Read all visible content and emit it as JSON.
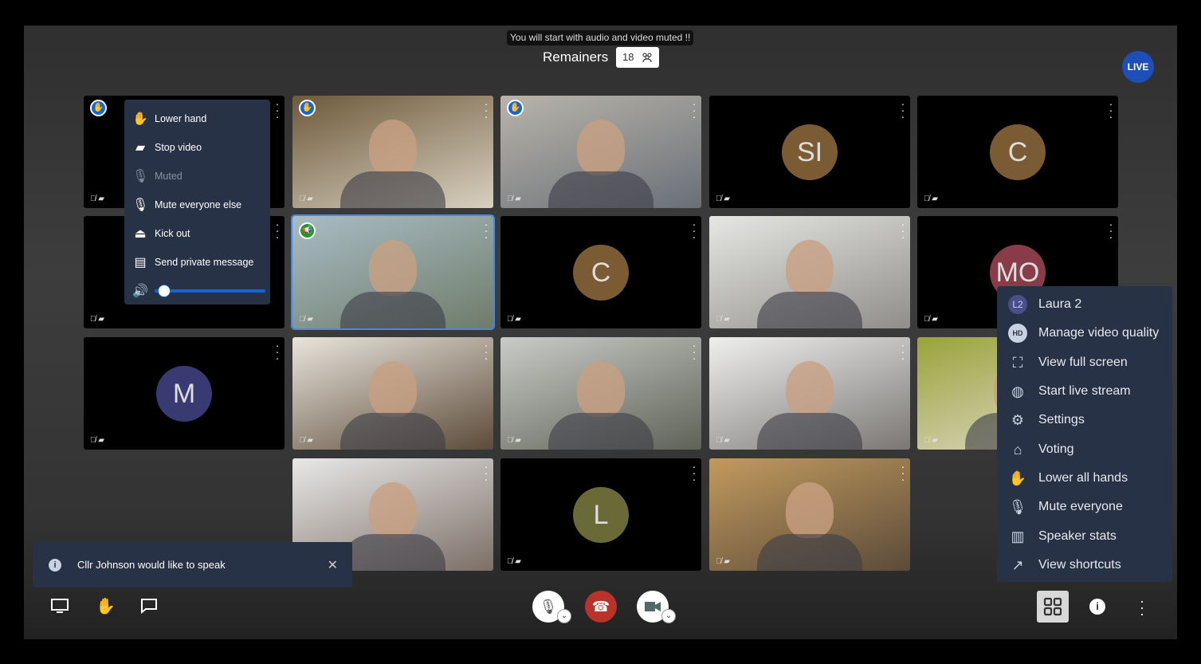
{
  "notice": "You will start with audio and video muted !!",
  "conference": {
    "title": "Remainers",
    "participant_count": "18"
  },
  "live_badge": "LIVE",
  "tiles": [
    {
      "type": "avatar",
      "initials": "",
      "hand": true
    },
    {
      "type": "video",
      "hand": true,
      "colors": [
        "#6e5a3c",
        "#d8d0c0"
      ]
    },
    {
      "type": "video",
      "hand": true,
      "colors": [
        "#b8b4aa",
        "#6a6f78"
      ]
    },
    {
      "type": "avatar",
      "initials": "SI",
      "color": "#7a5b33"
    },
    {
      "type": "avatar",
      "initials": "C",
      "color": "#7a5b33"
    },
    {
      "type": "avatar",
      "initials": ""
    },
    {
      "type": "video",
      "selected": true,
      "speaker": true,
      "colors": [
        "#a9bcc4",
        "#6f7c6a"
      ]
    },
    {
      "type": "avatar",
      "initials": "C",
      "color": "#7a5b33"
    },
    {
      "type": "video",
      "colors": [
        "#e6e6e4",
        "#8f8e8a"
      ]
    },
    {
      "type": "avatar",
      "initials": "MO",
      "color": "#8a3b4a"
    },
    {
      "type": "avatar",
      "initials": "M",
      "color": "#3a3a72"
    },
    {
      "type": "video",
      "colors": [
        "#e9e4dc",
        "#5c4b3a"
      ]
    },
    {
      "type": "video",
      "colors": [
        "#c9cbc8",
        "#5f6256"
      ]
    },
    {
      "type": "video",
      "colors": [
        "#efefee",
        "#7a7774"
      ]
    },
    {
      "type": "video",
      "colors": [
        "#9aa33a",
        "#e2ddd2"
      ]
    },
    {
      "type": "empty"
    },
    {
      "type": "video",
      "colors": [
        "#e8e8e8",
        "#7c6f66"
      ]
    },
    {
      "type": "avatar",
      "initials": "L",
      "color": "#6a6a38"
    },
    {
      "type": "video",
      "colors": [
        "#c29a5e",
        "#5b4b3a"
      ]
    }
  ],
  "participant_menu": {
    "items": [
      {
        "label": "Lower hand",
        "icon": "lower-hand-icon",
        "glyph": "✋"
      },
      {
        "label": "Stop video",
        "icon": "video-off-icon",
        "glyph": "▰"
      },
      {
        "label": "Muted",
        "icon": "mic-off-icon",
        "glyph": "🎙",
        "disabled": true
      },
      {
        "label": "Mute everyone else",
        "icon": "mute-everyone-icon",
        "glyph": "🎙"
      },
      {
        "label": "Kick out",
        "icon": "eject-icon",
        "glyph": "⏏"
      },
      {
        "label": "Send private message",
        "icon": "message-icon",
        "glyph": "▤"
      }
    ],
    "volume": 0.03
  },
  "overflow_menu": {
    "items": [
      {
        "label": "Laura 2",
        "icon": "avatar-l2",
        "glyph": "L2"
      },
      {
        "label": "Manage video quality",
        "icon": "hd-icon",
        "glyph": "HD"
      },
      {
        "label": "View full screen",
        "icon": "fullscreen-icon",
        "glyph": "⛶"
      },
      {
        "label": "Start live stream",
        "icon": "globe-icon",
        "glyph": "◍"
      },
      {
        "label": "Settings",
        "icon": "gear-icon",
        "glyph": "⚙"
      },
      {
        "label": "Voting",
        "icon": "ballot-icon",
        "glyph": "⌂"
      },
      {
        "label": "Lower all hands",
        "icon": "lower-hand-icon",
        "glyph": "✋"
      },
      {
        "label": "Mute everyone",
        "icon": "mute-everyone-icon",
        "glyph": "🎙"
      },
      {
        "label": "Speaker stats",
        "icon": "stats-icon",
        "glyph": "▥"
      },
      {
        "label": "View shortcuts",
        "icon": "external-link-icon",
        "glyph": "↗"
      }
    ]
  },
  "toast": {
    "message": "Cllr Johnson would like to speak"
  },
  "colors": {
    "menu_bg": "#273246",
    "accent": "#1565d8",
    "hangup": "#b8342a"
  }
}
